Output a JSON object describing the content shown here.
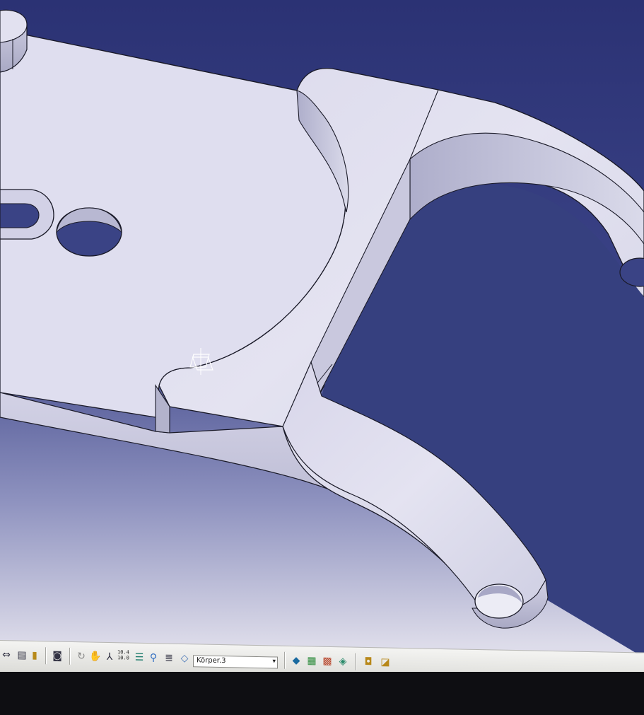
{
  "toolbar": {
    "body_selector": {
      "value": "Körper.3",
      "arrow": "▾"
    },
    "coordinate_readout": {
      "x": "10.4",
      "y": "10.0"
    },
    "icons": [
      "fit-all-icon",
      "save-icon",
      "lock-icon",
      "camera-icon",
      "rotate-icon",
      "pan-hand-icon",
      "axis-icon",
      "coordinate-icon",
      "layers-icon",
      "filter-icon",
      "list-icon",
      "material-icon",
      "render-icon",
      "grid-icon",
      "apply-material-icon",
      "color-icon",
      "analysis-icon",
      "draft-icon"
    ]
  },
  "viewport": {
    "background_top": "#2b3274",
    "background_bottom": "#e6e4f0",
    "part_face": "#dcdcec",
    "part_side": "#b8b8d0",
    "edge": "#1a1a28"
  }
}
